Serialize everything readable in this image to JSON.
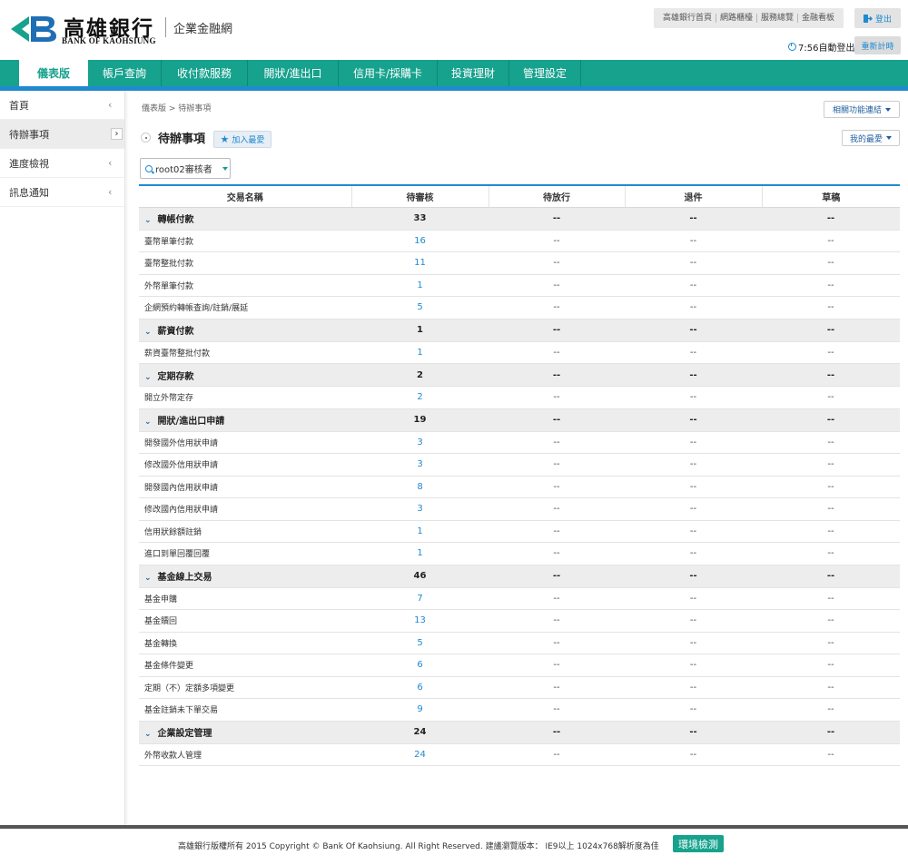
{
  "header": {
    "bank_name": "高雄銀行",
    "bank_name_en": "BANK OF KAOHSIUNG",
    "subtitle": "企業金融網",
    "top_links": [
      "高雄銀行首頁",
      "網路櫃檯",
      "服務總覽",
      "金融看板"
    ],
    "logout_label": "登出",
    "timer_text": "7:56自動登出",
    "reset_label": "重新計時"
  },
  "nav": {
    "items": [
      "儀表版",
      "帳戶查詢",
      "收付款服務",
      "開狀/進出口",
      "信用卡/採購卡",
      "投資理財",
      "管理設定"
    ]
  },
  "sidebar": {
    "items": [
      "首頁",
      "待辦事項",
      "進度檢視",
      "訊息通知"
    ]
  },
  "main": {
    "breadcrumb": "儀表版 > 待辦事項",
    "related_label": "相關功能連結",
    "favorite_label": "我的最愛",
    "title": "待辦事項",
    "add_favorite_label": "加入最愛",
    "role_select": "root02審核者"
  },
  "table": {
    "headers": [
      "交易名稱",
      "待審核",
      "待放行",
      "退件",
      "草稿"
    ],
    "groups": [
      {
        "name": "轉帳付款",
        "pending": "33",
        "release": "--",
        "reject": "--",
        "draft": "--",
        "items": [
          {
            "name": "臺幣單筆付款",
            "pending": "16",
            "release": "--",
            "reject": "--",
            "draft": "--"
          },
          {
            "name": "臺幣整批付款",
            "pending": "11",
            "release": "--",
            "reject": "--",
            "draft": "--"
          },
          {
            "name": "外幣單筆付款",
            "pending": "1",
            "release": "--",
            "reject": "--",
            "draft": "--"
          },
          {
            "name": "企網預約轉帳查詢/註銷/展延",
            "pending": "5",
            "release": "--",
            "reject": "--",
            "draft": "--"
          }
        ]
      },
      {
        "name": "薪資付款",
        "pending": "1",
        "release": "--",
        "reject": "--",
        "draft": "--",
        "items": [
          {
            "name": "薪資臺幣整批付款",
            "pending": "1",
            "release": "--",
            "reject": "--",
            "draft": "--"
          }
        ]
      },
      {
        "name": "定期存款",
        "pending": "2",
        "release": "--",
        "reject": "--",
        "draft": "--",
        "items": [
          {
            "name": "開立外幣定存",
            "pending": "2",
            "release": "--",
            "reject": "--",
            "draft": "--"
          }
        ]
      },
      {
        "name": "開狀/進出口申請",
        "pending": "19",
        "release": "--",
        "reject": "--",
        "draft": "--",
        "items": [
          {
            "name": "開發國外信用狀申請",
            "pending": "3",
            "release": "--",
            "reject": "--",
            "draft": "--"
          },
          {
            "name": "修改國外信用狀申請",
            "pending": "3",
            "release": "--",
            "reject": "--",
            "draft": "--"
          },
          {
            "name": "開發國內信用狀申請",
            "pending": "8",
            "release": "--",
            "reject": "--",
            "draft": "--"
          },
          {
            "name": "修改國內信用狀申請",
            "pending": "3",
            "release": "--",
            "reject": "--",
            "draft": "--"
          },
          {
            "name": "信用狀餘額註銷",
            "pending": "1",
            "release": "--",
            "reject": "--",
            "draft": "--"
          },
          {
            "name": "進口到單回覆回覆",
            "pending": "1",
            "release": "--",
            "reject": "--",
            "draft": "--"
          }
        ]
      },
      {
        "name": "基金線上交易",
        "pending": "46",
        "release": "--",
        "reject": "--",
        "draft": "--",
        "items": [
          {
            "name": "基金申購",
            "pending": "7",
            "release": "--",
            "reject": "--",
            "draft": "--"
          },
          {
            "name": "基金贖回",
            "pending": "13",
            "release": "--",
            "reject": "--",
            "draft": "--"
          },
          {
            "name": "基金轉換",
            "pending": "5",
            "release": "--",
            "reject": "--",
            "draft": "--"
          },
          {
            "name": "基金條件變更",
            "pending": "6",
            "release": "--",
            "reject": "--",
            "draft": "--"
          },
          {
            "name": "定期（不）定額多項變更",
            "pending": "6",
            "release": "--",
            "reject": "--",
            "draft": "--"
          },
          {
            "name": "基金註銷未下單交易",
            "pending": "9",
            "release": "--",
            "reject": "--",
            "draft": "--"
          }
        ]
      },
      {
        "name": "企業設定管理",
        "pending": "24",
        "release": "--",
        "reject": "--",
        "draft": "--",
        "items": [
          {
            "name": "外幣收款人管理",
            "pending": "24",
            "release": "--",
            "reject": "--",
            "draft": "--"
          }
        ]
      }
    ]
  },
  "footer": {
    "copyright": "高雄銀行版權所有 2015 Copyright © Bank Of Kaohsiung. All Right Reserved. 建議瀏覽版本： IE9以上 1024x768解析度為佳",
    "env_check_label": "環境檢測"
  },
  "colors": {
    "brand_green": "#16a28d",
    "accent_blue": "#1f8ad1"
  }
}
